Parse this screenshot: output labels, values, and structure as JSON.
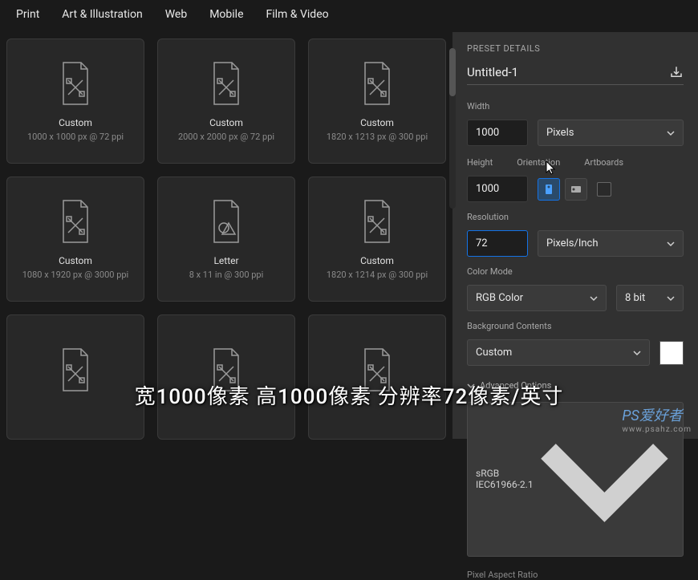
{
  "tabs": [
    "Print",
    "Art & Illustration",
    "Web",
    "Mobile",
    "Film & Video"
  ],
  "presets": [
    {
      "title": "Custom",
      "meta": "1000 x 1000 px @ 72 ppi",
      "icon": "doc-tools"
    },
    {
      "title": "Custom",
      "meta": "2000 x 2000 px @ 72 ppi",
      "icon": "doc-tools"
    },
    {
      "title": "Custom",
      "meta": "1820 x 1213 px @ 300 ppi",
      "icon": "doc-tools"
    },
    {
      "title": "Custom",
      "meta": "1080 x 1920 px @ 3000 ppi",
      "icon": "doc-tools"
    },
    {
      "title": "Letter",
      "meta": "8 x 11 in @ 300 ppi",
      "icon": "doc-shape"
    },
    {
      "title": "Custom",
      "meta": "1820 x 1214 px @ 300 ppi",
      "icon": "doc-tools"
    },
    {
      "title": "",
      "meta": "",
      "icon": "doc-tools"
    },
    {
      "title": "",
      "meta": "",
      "icon": "doc-tools"
    },
    {
      "title": "",
      "meta": "",
      "icon": "doc-tools"
    }
  ],
  "panel": {
    "header": "PRESET DETAILS",
    "name": "Untitled-1",
    "width_label": "Width",
    "width_value": "1000",
    "units": "Pixels",
    "height_label": "Height",
    "height_value": "1000",
    "orientation_label": "Orientation",
    "artboards_label": "Artboards",
    "resolution_label": "Resolution",
    "resolution_value": "72",
    "resolution_units": "Pixels/Inch",
    "colormode_label": "Color Mode",
    "colormode_value": "RGB Color",
    "bitdepth": "8 bit",
    "bg_label": "Background Contents",
    "bg_value": "Custom",
    "advanced_label": "Advanced Options",
    "profile": "sRGB IEC61966-2.1",
    "aspect_label": "Pixel Aspect Ratio"
  },
  "subtitle": "宽1000像素 高1000像素 分辨率72像素/英寸",
  "watermark": {
    "main": "PS爱好者",
    "sub": "www.psahz.com"
  }
}
